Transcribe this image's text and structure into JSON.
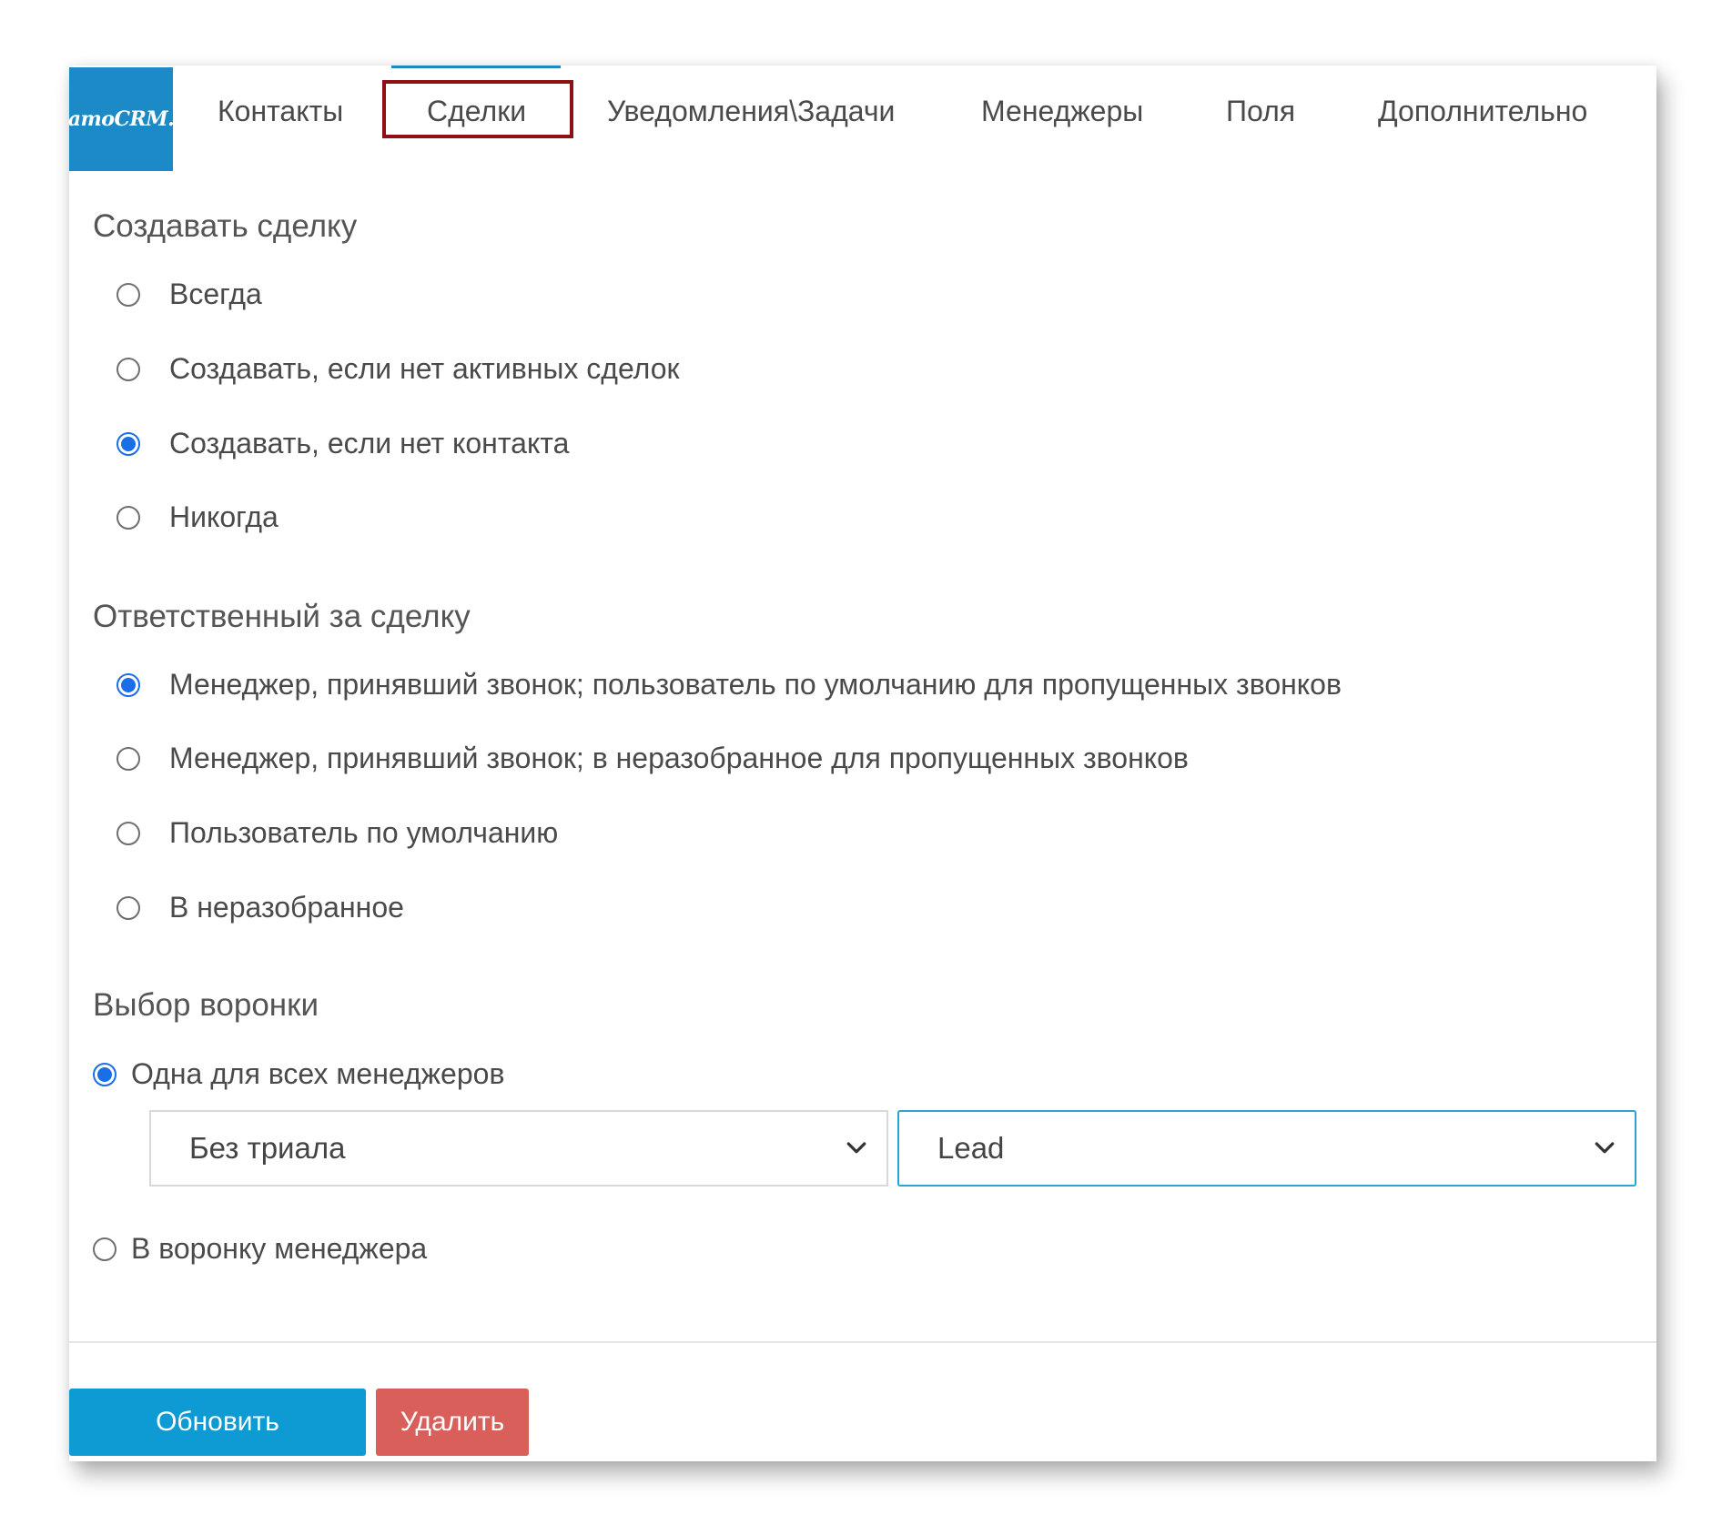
{
  "logo": {
    "text": "amoCRM."
  },
  "tabs": [
    {
      "label": "Контакты"
    },
    {
      "label": "Сделки",
      "active": true
    },
    {
      "label": "Уведомления\\Задачи"
    },
    {
      "label": "Менеджеры"
    },
    {
      "label": "Поля"
    },
    {
      "label": "Дополнительно"
    }
  ],
  "create_deal": {
    "title": "Создавать сделку",
    "options": [
      {
        "label": "Всегда",
        "checked": false
      },
      {
        "label": "Создавать, если нет активных сделок",
        "checked": false
      },
      {
        "label": "Создавать, если нет контакта",
        "checked": true
      },
      {
        "label": "Никогда",
        "checked": false
      }
    ]
  },
  "responsible": {
    "title": "Ответственный за сделку",
    "options": [
      {
        "label": "Менеджер, принявший звонок; пользователь по умолчанию для пропущенных звонков",
        "checked": true
      },
      {
        "label": "Менеджер, принявший звонок; в неразобранное для пропущенных звонков",
        "checked": false
      },
      {
        "label": "Пользователь по умолчанию",
        "checked": false
      },
      {
        "label": "В неразобранное",
        "checked": false
      }
    ]
  },
  "funnel": {
    "title": "Выбор воронки",
    "option_one": {
      "label": "Одна для всех менеджеров",
      "checked": true
    },
    "pipeline_select": {
      "value": "Без триала"
    },
    "stage_select": {
      "value": "Lead"
    },
    "option_manager": {
      "label": "В воронку менеджера",
      "checked": false
    }
  },
  "buttons": {
    "update": "Обновить",
    "delete": "Удалить"
  },
  "colors": {
    "logo_bg": "#1b8ac6",
    "radio_checked": "#1a6fe8",
    "tab_highlight": "#8c1014",
    "update_button": "#0e9bd3",
    "delete_button": "#d9605a"
  }
}
